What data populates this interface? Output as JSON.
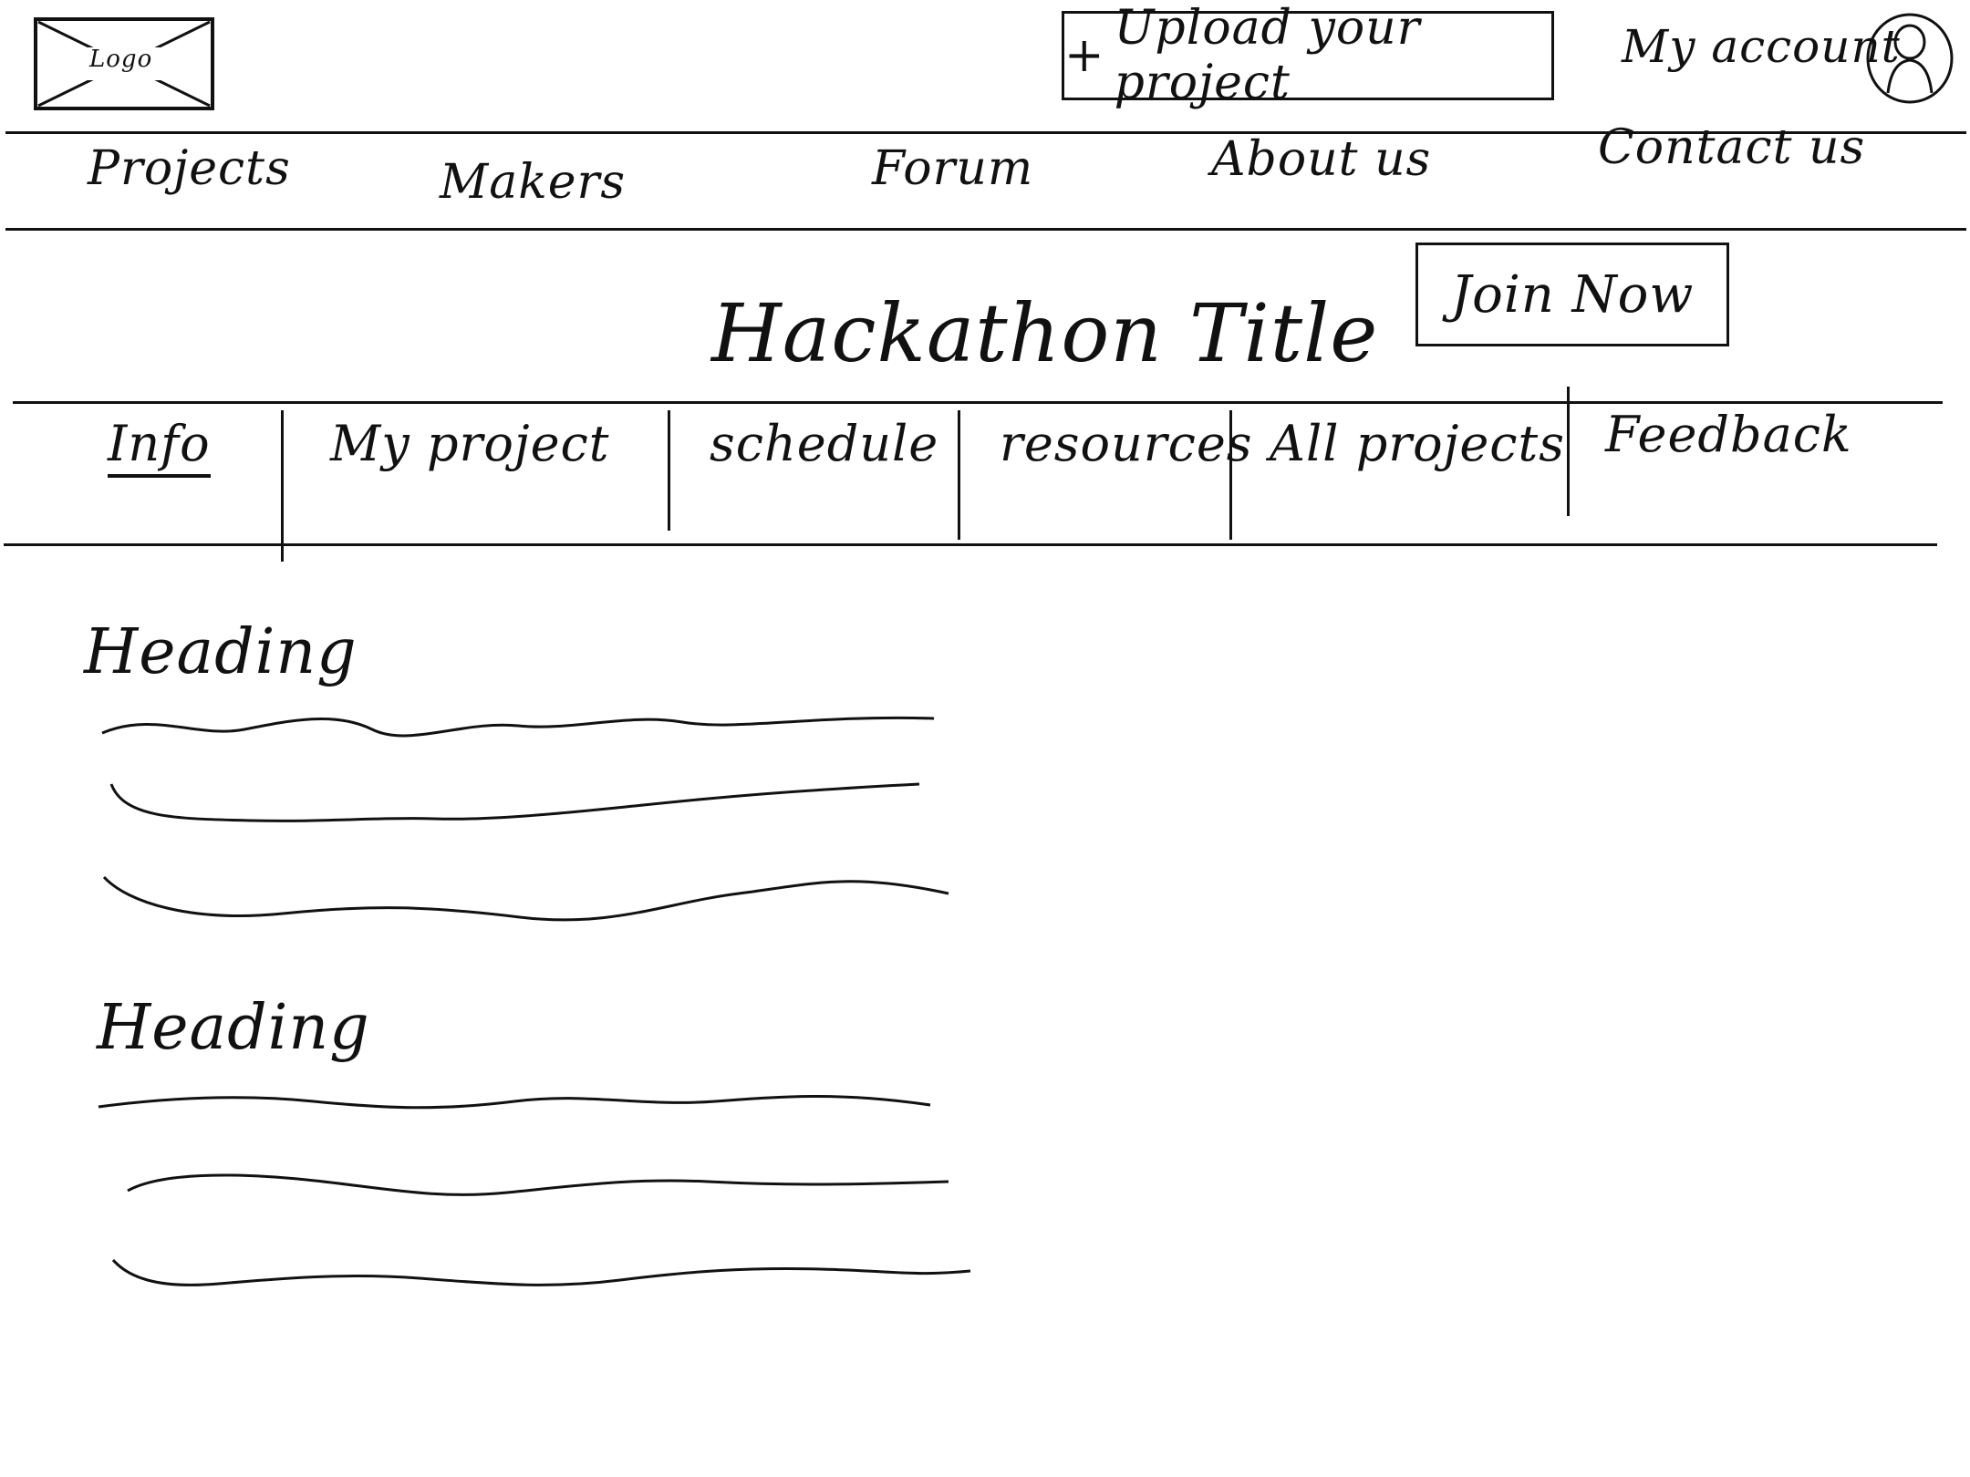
{
  "header": {
    "logo_label": "Logo",
    "upload_button": "Upload your project",
    "upload_icon": "plus-icon",
    "account_label": "My account",
    "avatar_icon": "user-avatar-icon"
  },
  "nav": {
    "items": [
      "Projects",
      "Makers",
      "Forum",
      "About us",
      "Contact us"
    ]
  },
  "hackathon": {
    "title": "Hackathon Title",
    "join_button": "Join Now"
  },
  "tabs": {
    "items": [
      "Info",
      "My project",
      "schedule",
      "resources",
      "All projects",
      "Feedback"
    ],
    "active": "Info"
  },
  "content": {
    "sections": [
      {
        "heading": "Heading",
        "placeholder_line_count": 3
      },
      {
        "heading": "Heading",
        "placeholder_line_count": 3
      }
    ]
  }
}
